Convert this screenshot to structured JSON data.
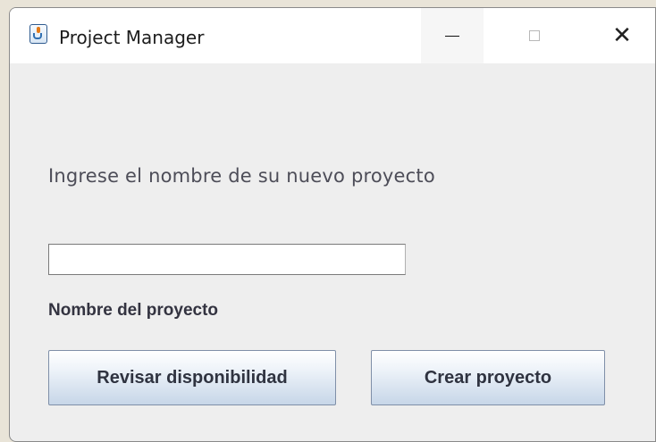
{
  "window": {
    "title": "Project Manager",
    "icon": "java-icon",
    "controls": {
      "minimize": "minimize-icon",
      "maximize": "maximize-icon",
      "close": "close-icon",
      "close_glyph": "✕"
    }
  },
  "form": {
    "prompt": "Ingrese el nombre de su nuevo proyecto",
    "name_input": {
      "value": "",
      "placeholder": ""
    },
    "name_label": "Nombre del proyecto",
    "check_button_label": "Revisar disponibilidad",
    "create_button_label": "Crear proyecto"
  },
  "colors": {
    "window_bg": "#eeeeee",
    "titlebar_bg": "#ffffff",
    "button_gradient_top": "#ffffff",
    "button_gradient_bottom": "#c7d6e8"
  }
}
